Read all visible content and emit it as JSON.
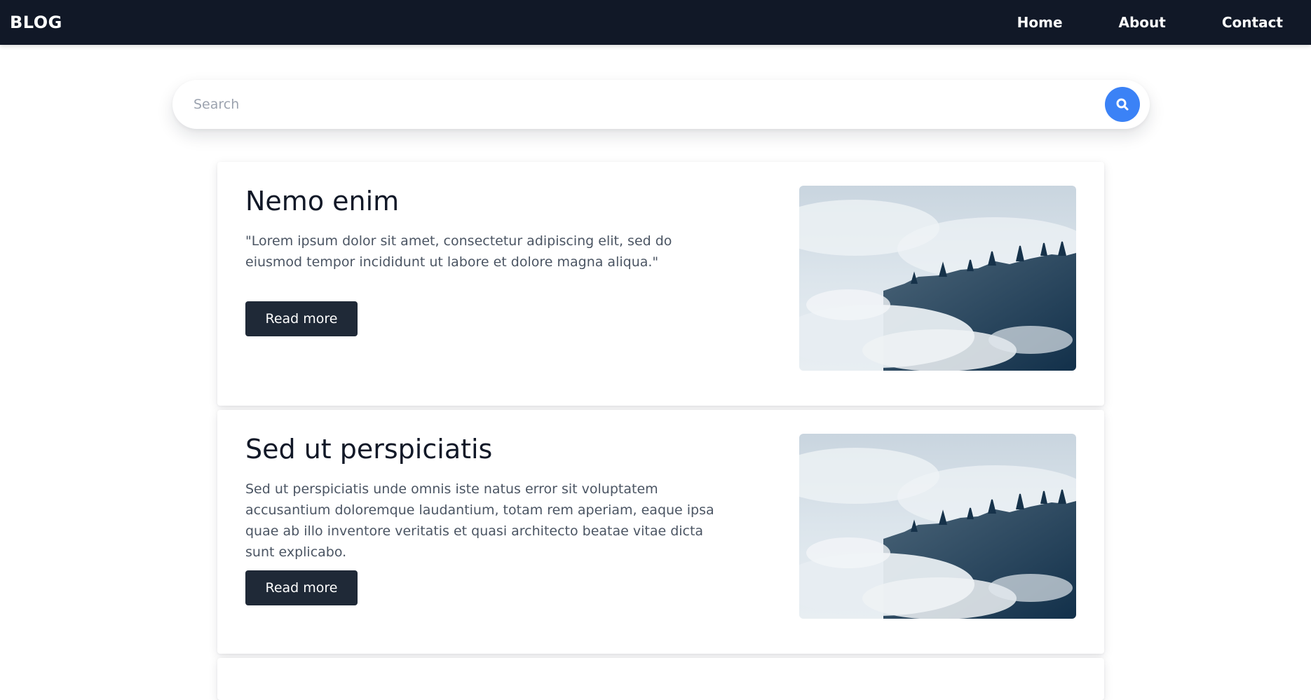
{
  "nav": {
    "brand": "BLOG",
    "links": [
      "Home",
      "About",
      "Contact"
    ]
  },
  "search": {
    "placeholder": "Search",
    "value": "",
    "button_icon": "search-icon"
  },
  "posts": [
    {
      "title": "Nemo enim",
      "excerpt": "\"Lorem ipsum dolor sit amet, consectetur adipiscing elit, sed do eiusmod tempor incididunt ut labore et dolore magna aliqua.\"",
      "button_label": "Read more",
      "image": "foggy-forest-image"
    },
    {
      "title": "Sed ut perspiciatis",
      "excerpt": "Sed ut perspiciatis unde omnis iste natus error sit voluptatem accusantium doloremque laudantium, totam rem aperiam, eaque ipsa quae ab illo inventore veritatis et quasi architecto beatae vitae dicta sunt explicabo.",
      "button_label": "Read more",
      "image": "foggy-forest-image"
    }
  ],
  "colors": {
    "navbar": "#111827",
    "search_button": "#3b82f6",
    "read_more_button": "#1f2937"
  }
}
